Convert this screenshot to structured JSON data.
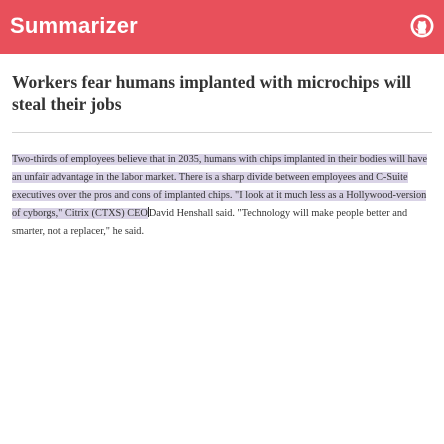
{
  "header": {
    "title": "Summarizer",
    "github_icon": "github-icon",
    "background_color": "#e8505b"
  },
  "article": {
    "headline": "Workers fear humans implanted with microchips will steal their jobs",
    "highlighted_text": "Two-thirds of employees believe that in 2035, humans with chips implanted in their bodies will have an unfair advantage in the labor market. There is a sharp divide between employees and C-Suite executives over the pros and cons of implanted chips. \"I look at it much less as a Hollywood-version of cyborgs,\" Citrix (CTXS) CEO",
    "remaining_text": "David Henshall said. \"Technology will make people better and smarter, not a replacer,\" he said.",
    "highlight_color": "#d9d3e6"
  }
}
